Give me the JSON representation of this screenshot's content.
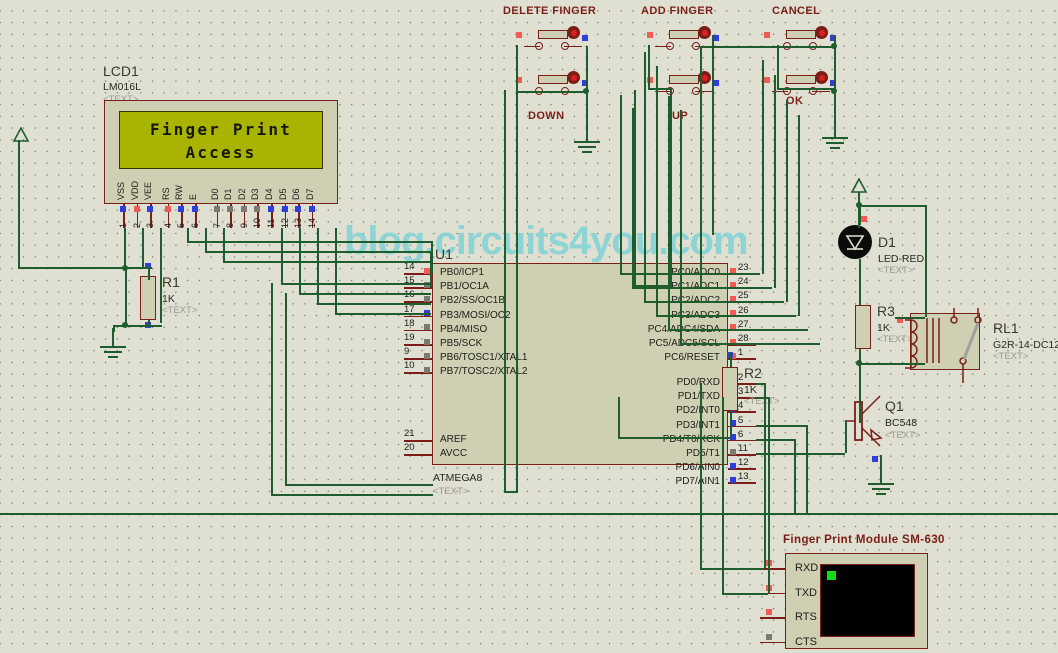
{
  "watermark": "blog.circuits4you.com",
  "lcd": {
    "ref": "LCD1",
    "part": "LM016L",
    "text_tag": "<TEXT>",
    "line1": "Finger Print",
    "line2": "Access",
    "pins": [
      {
        "num": "1",
        "name": "VSS",
        "color": "blue"
      },
      {
        "num": "2",
        "name": "VDD",
        "color": "red"
      },
      {
        "num": "3",
        "name": "VEE",
        "color": "blue"
      },
      {
        "num": "4",
        "name": "RS",
        "color": "red"
      },
      {
        "num": "5",
        "name": "RW",
        "color": "blue"
      },
      {
        "num": "6",
        "name": "E",
        "color": "blue"
      },
      {
        "num": "7",
        "name": "D0",
        "color": "grey"
      },
      {
        "num": "8",
        "name": "D1",
        "color": "grey"
      },
      {
        "num": "9",
        "name": "D2",
        "color": "grey"
      },
      {
        "num": "10",
        "name": "D3",
        "color": "grey"
      },
      {
        "num": "11",
        "name": "D4",
        "color": "blue"
      },
      {
        "num": "12",
        "name": "D5",
        "color": "blue"
      },
      {
        "num": "13",
        "name": "D6",
        "color": "blue"
      },
      {
        "num": "14",
        "name": "D7",
        "color": "blue"
      }
    ]
  },
  "mcu": {
    "ref": "U1",
    "part": "ATMEGA8",
    "text_tag": "<TEXT>",
    "left_pins": [
      {
        "num": "14",
        "name": "PB0/ICP1",
        "color": "red"
      },
      {
        "num": "15",
        "name": "PB1/OC1A",
        "color": "grey"
      },
      {
        "num": "16",
        "name": "PB2/SS/OC1B",
        "color": "grey"
      },
      {
        "num": "17",
        "name": "PB3/MOSI/OC2",
        "color": "blue"
      },
      {
        "num": "18",
        "name": "PB4/MISO",
        "color": "grey"
      },
      {
        "num": "19",
        "name": "PB5/SCK",
        "color": "grey"
      },
      {
        "num": "9",
        "name": "PB6/TOSC1/XTAL1",
        "color": "grey"
      },
      {
        "num": "10",
        "name": "PB7/TOSC2/XTAL2",
        "color": "grey"
      }
    ],
    "left_pins_lower": [
      {
        "num": "21",
        "name": "AREF",
        "color": "none"
      },
      {
        "num": "20",
        "name": "AVCC",
        "color": "none"
      }
    ],
    "right_pins_c": [
      {
        "num": "23",
        "name": "PC0/ADC0",
        "color": "red"
      },
      {
        "num": "24",
        "name": "PC1/ADC1",
        "color": "red"
      },
      {
        "num": "25",
        "name": "PC2/ADC2",
        "color": "red"
      },
      {
        "num": "26",
        "name": "PC3/ADC3",
        "color": "red"
      },
      {
        "num": "27",
        "name": "PC4/ADC4/SDA",
        "color": "red"
      },
      {
        "num": "28",
        "name": "PC5/ADC5/SCL",
        "color": "red"
      },
      {
        "num": "1",
        "name": "PC6/RESET",
        "color": "red"
      }
    ],
    "right_pins_d": [
      {
        "num": "2",
        "name": "PD0/RXD",
        "color": "red"
      },
      {
        "num": "3",
        "name": "PD1/TXD",
        "color": "red"
      },
      {
        "num": "4",
        "name": "PD2/INT0",
        "color": "blue"
      },
      {
        "num": "5",
        "name": "PD3/INT1",
        "color": "blue"
      },
      {
        "num": "6",
        "name": "PD4/T0/XCK",
        "color": "blue"
      },
      {
        "num": "11",
        "name": "PD5/T1",
        "color": "grey"
      },
      {
        "num": "12",
        "name": "PD6/AIN0",
        "color": "blue"
      },
      {
        "num": "13",
        "name": "PD7/AIN1",
        "color": "blue"
      }
    ]
  },
  "switch_groups": [
    {
      "title": "DELETE FINGER",
      "sub": "DOWN"
    },
    {
      "title": "ADD FINGER",
      "sub": "UP"
    },
    {
      "title": "CANCEL",
      "sub": "OK"
    }
  ],
  "resistors": [
    {
      "ref": "R1",
      "value": "1K",
      "text_tag": "<TEXT>"
    },
    {
      "ref": "R2",
      "value": "1K",
      "text_tag": "<TEXT>"
    },
    {
      "ref": "R3",
      "value": "1K",
      "text_tag": "<TEXT>"
    }
  ],
  "led": {
    "ref": "D1",
    "part": "LED-RED",
    "text_tag": "<TEXT>"
  },
  "relay": {
    "ref": "RL1",
    "part": "G2R-14-DC12",
    "text_tag": "<TEXT>"
  },
  "transistor": {
    "ref": "Q1",
    "part": "BC548",
    "text_tag": "<TEXT>"
  },
  "fp_module": {
    "title": "Finger Print Module SM-630",
    "pins": [
      "RXD",
      "TXD",
      "RTS",
      "CTS"
    ],
    "pin_colors": [
      "red",
      "red",
      "red",
      "grey"
    ]
  },
  "colors": {
    "background": "#dfe0d2",
    "wire": "#1f5c2e",
    "component_outline": "#7b1e17",
    "component_fill": "#cfcfb4",
    "lcd_screen": "#a8b400",
    "watermark": "#8fd4d4",
    "pin_red": "#f05b56",
    "pin_blue": "#2f3ed8",
    "pin_grey": "#7a7a72"
  }
}
